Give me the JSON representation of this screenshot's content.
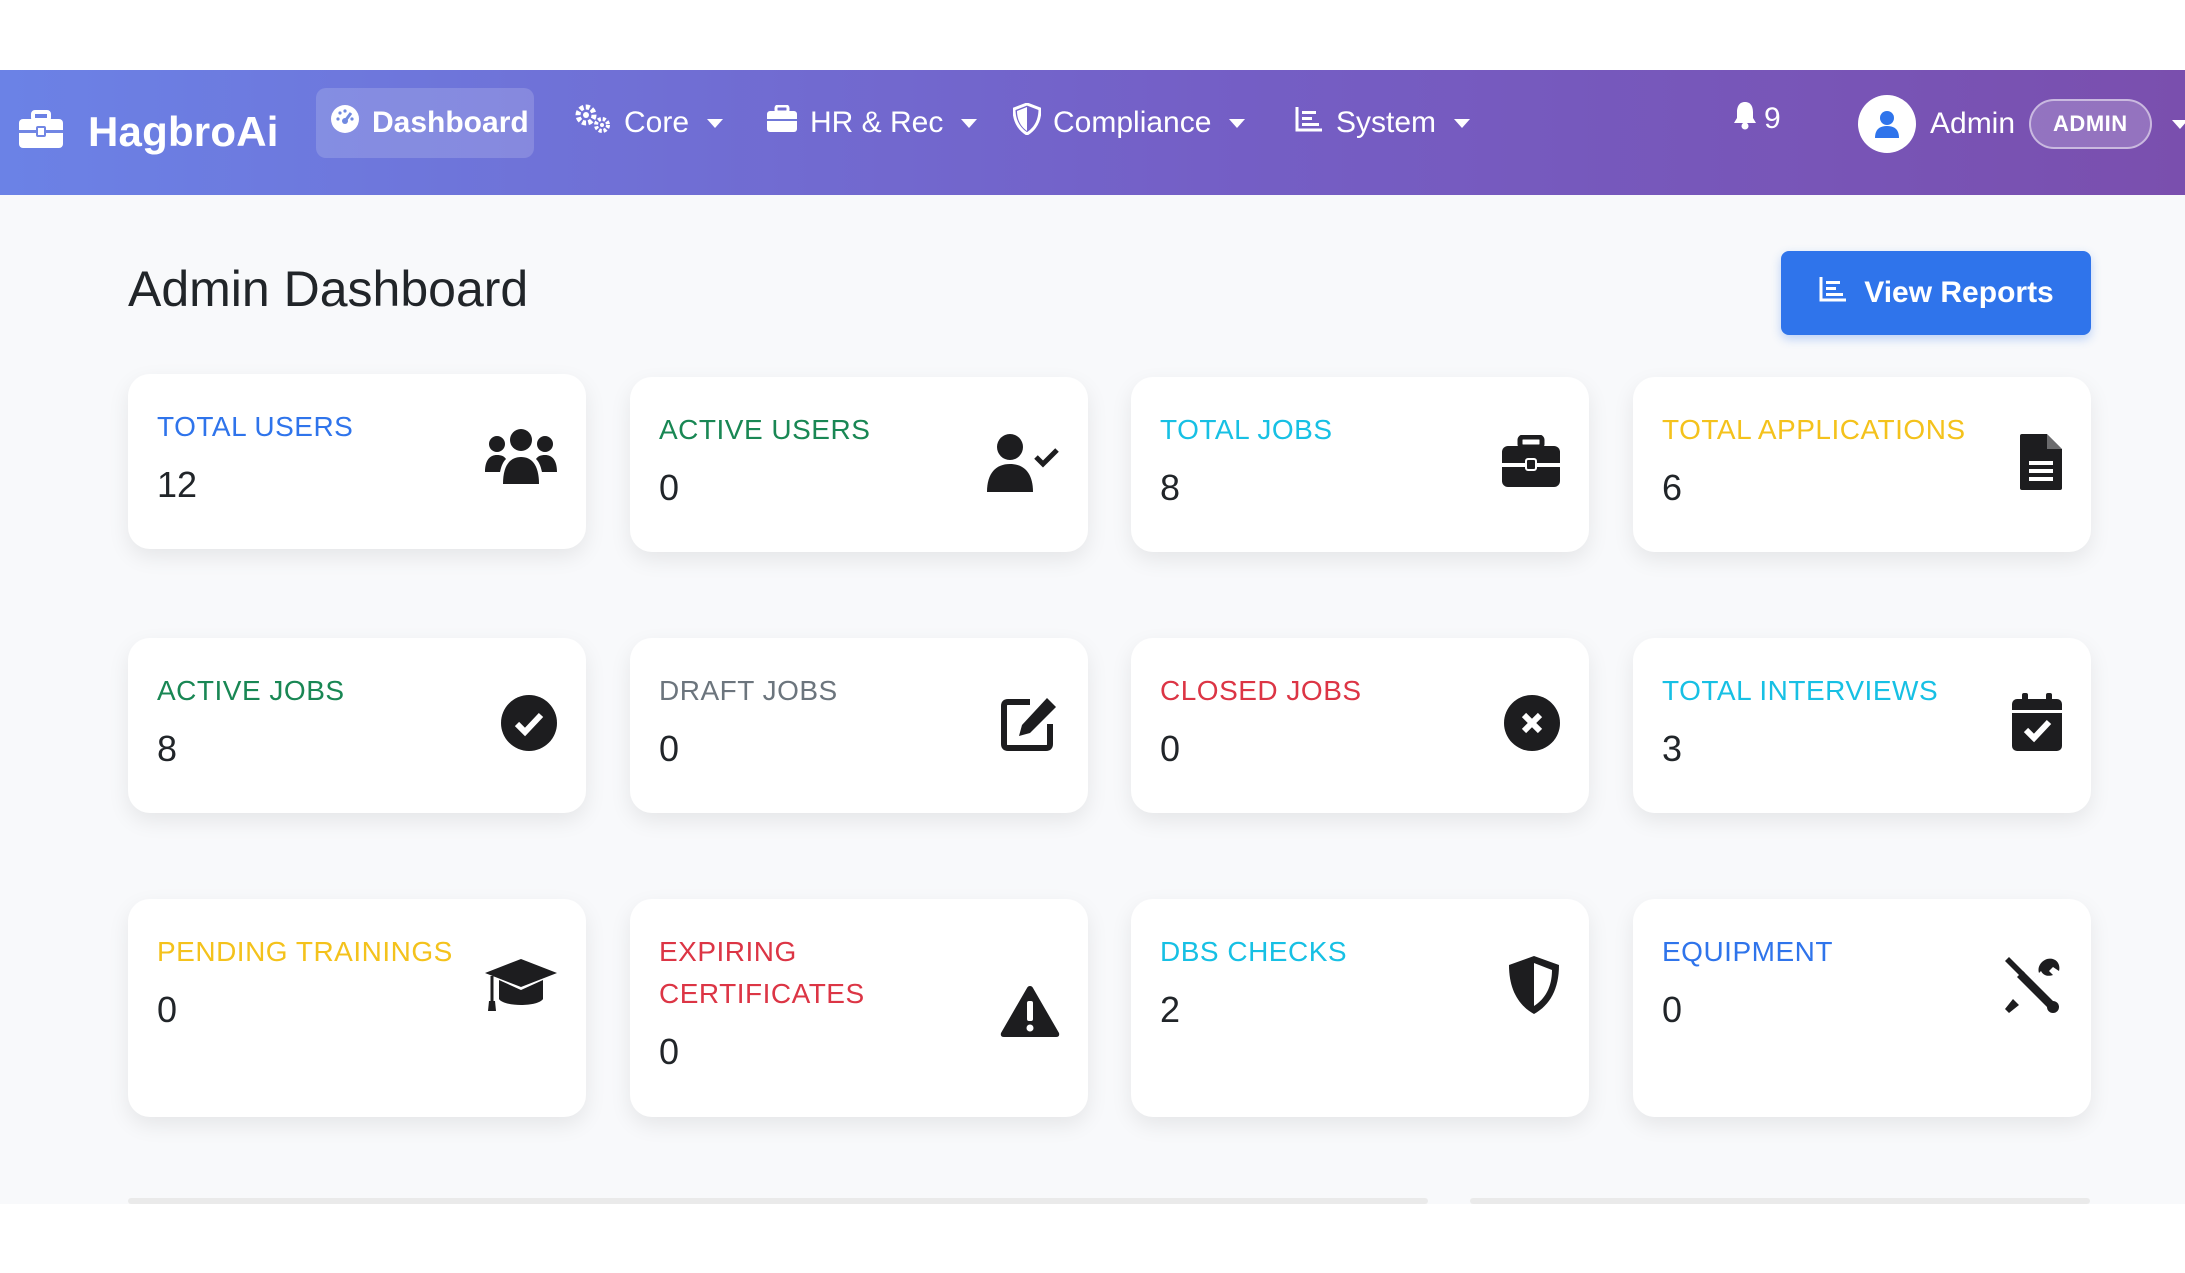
{
  "navbar": {
    "brand": "HagbroAi",
    "items": [
      {
        "label": "Dashboard",
        "icon": "gauge-icon",
        "active": true
      },
      {
        "label": "Core",
        "icon": "cogs-icon"
      },
      {
        "label": "HR & Rec",
        "icon": "briefcase-icon"
      },
      {
        "label": "Compliance",
        "icon": "shield-icon"
      },
      {
        "label": "System",
        "icon": "chart-icon"
      }
    ],
    "notifications": "9",
    "user_name": "Admin",
    "role": "ADMIN"
  },
  "page": {
    "title": "Admin Dashboard",
    "view_reports": "View Reports"
  },
  "cards": [
    {
      "label": "TOTAL USERS",
      "value": "12",
      "color": "#2f74eb",
      "icon": "users-icon"
    },
    {
      "label": "ACTIVE USERS",
      "value": "0",
      "color": "#198754",
      "icon": "user-check-icon"
    },
    {
      "label": "TOTAL JOBS",
      "value": "8",
      "color": "#17c0e4",
      "icon": "briefcase-icon"
    },
    {
      "label": "TOTAL APPLICATIONS",
      "value": "6",
      "color": "#f4c21c",
      "icon": "file-icon"
    },
    {
      "label": "ACTIVE JOBS",
      "value": "8",
      "color": "#198754",
      "icon": "check-circle-icon"
    },
    {
      "label": "DRAFT JOBS",
      "value": "0",
      "color": "#6c757d",
      "icon": "edit-icon"
    },
    {
      "label": "CLOSED JOBS",
      "value": "0",
      "color": "#dc3545",
      "icon": "x-circle-icon"
    },
    {
      "label": "TOTAL INTERVIEWS",
      "value": "3",
      "color": "#17c0e4",
      "icon": "calendar-check-icon"
    },
    {
      "label": "PENDING TRAININGS",
      "value": "0",
      "color": "#f4c21c",
      "icon": "graduation-cap-icon"
    },
    {
      "label": "EXPIRING CERTIFICATES",
      "label_line1": "EXPIRING",
      "label_line2": "CERTIFICATES",
      "value": "0",
      "color": "#dc3545",
      "icon": "warning-icon"
    },
    {
      "label": "DBS CHECKS",
      "value": "2",
      "color": "#17c0e4",
      "icon": "shield-icon"
    },
    {
      "label": "EQUIPMENT",
      "value": "0",
      "color": "#2f74eb",
      "icon": "tools-icon"
    }
  ]
}
